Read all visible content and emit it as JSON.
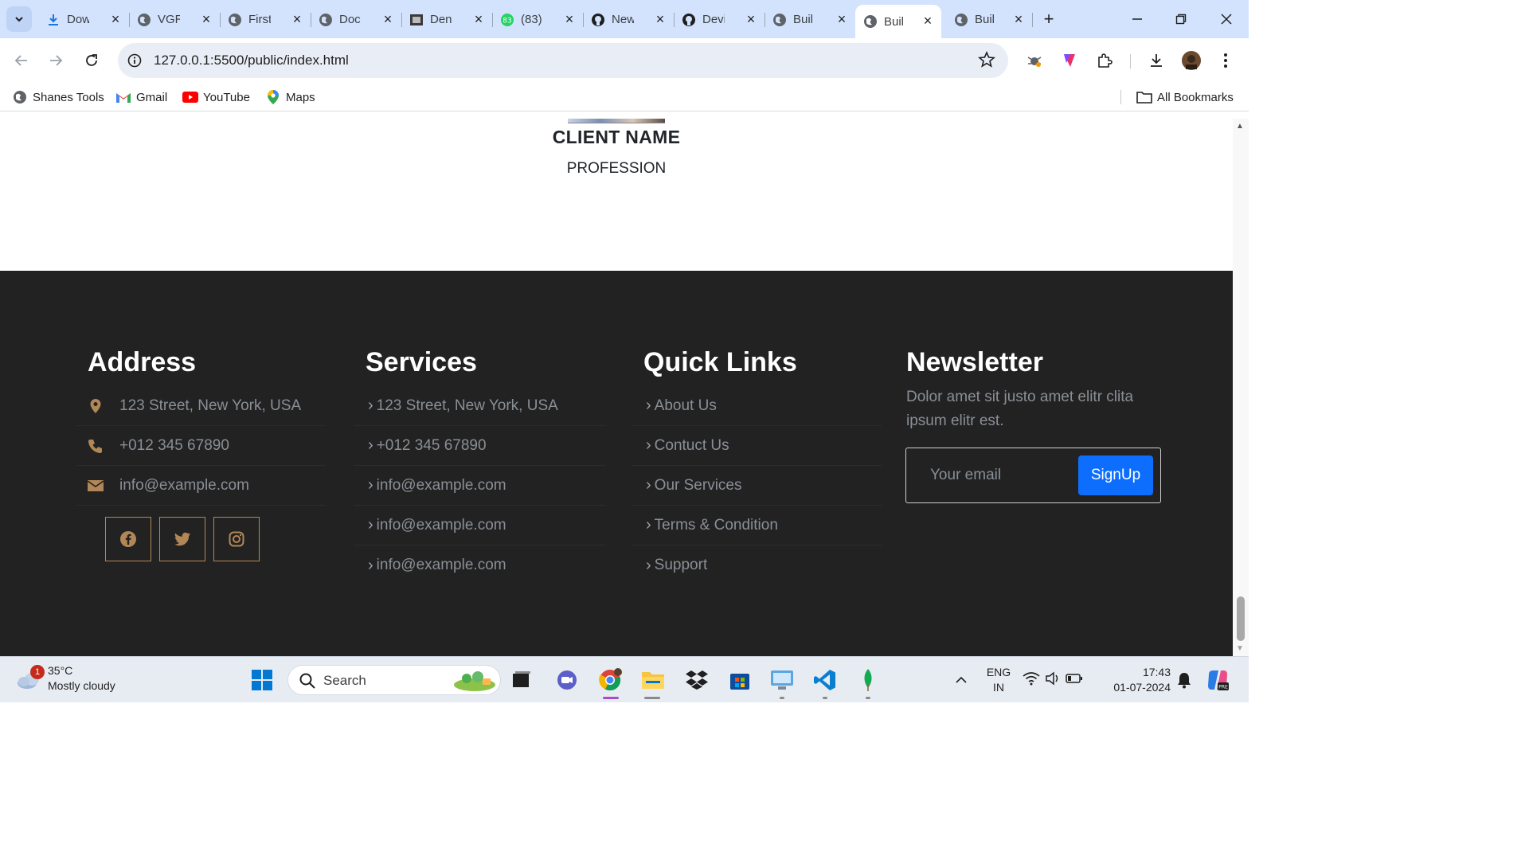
{
  "browser": {
    "tabs": [
      {
        "title": "Dow",
        "icon": "download-icon"
      },
      {
        "title": "VGR",
        "icon": "globe-icon"
      },
      {
        "title": "First",
        "icon": "globe-icon"
      },
      {
        "title": "Doc",
        "icon": "globe-icon"
      },
      {
        "title": "Den",
        "icon": "image-icon"
      },
      {
        "title": "(83)",
        "icon": "chat-icon"
      },
      {
        "title": "New",
        "icon": "github-icon"
      },
      {
        "title": "Devi",
        "icon": "github-icon"
      },
      {
        "title": "Buil",
        "icon": "globe-icon"
      },
      {
        "title": "Buil",
        "icon": "globe-icon",
        "active": true
      },
      {
        "title": "Buil",
        "icon": "globe-icon"
      }
    ],
    "url": "127.0.0.1:5500/public/index.html",
    "bookmarks": [
      {
        "label": "Shanes Tools",
        "icon": "globe-icon"
      },
      {
        "label": "Gmail",
        "icon": "gmail-icon"
      },
      {
        "label": "YouTube",
        "icon": "youtube-icon"
      },
      {
        "label": "Maps",
        "icon": "maps-icon"
      }
    ],
    "all_bookmarks": "All Bookmarks"
  },
  "testimonial": {
    "client_name": "CLIENT NAME",
    "profession": "PROFESSION"
  },
  "footer": {
    "address": {
      "title": "Address",
      "items": [
        {
          "text": "123 Street, New York, USA",
          "icon": "map-marker-icon"
        },
        {
          "text": "+012 345 67890",
          "icon": "phone-icon"
        },
        {
          "text": "info@example.com",
          "icon": "envelope-icon"
        }
      ],
      "social": [
        "facebook-icon",
        "twitter-icon",
        "instagram-icon"
      ]
    },
    "services": {
      "title": "Services",
      "items": [
        "123 Street, New York, USA",
        "+012 345 67890",
        "info@example.com",
        "info@example.com",
        "info@example.com"
      ]
    },
    "quick_links": {
      "title": "Quick Links",
      "items": [
        "About Us",
        "Contuct Us",
        "Our Services",
        "Terms & Condition",
        "Support"
      ]
    },
    "newsletter": {
      "title": "Newsletter",
      "text": "Dolor amet sit justo amet elitr clita ipsum elitr est.",
      "placeholder": "Your email",
      "button": "SignUp"
    }
  },
  "taskbar": {
    "weather_temp": "35°C",
    "weather_desc": "Mostly cloudy",
    "weather_badge": "1",
    "search_label": "Search",
    "lang_top": "ENG",
    "lang_bottom": "IN",
    "time": "17:43",
    "date": "01-07-2024"
  },
  "colors": {
    "footer_bg": "#222222",
    "accent_brown": "#b28757",
    "button_blue": "#0d6efd",
    "muted_text": "#8a8f96"
  }
}
